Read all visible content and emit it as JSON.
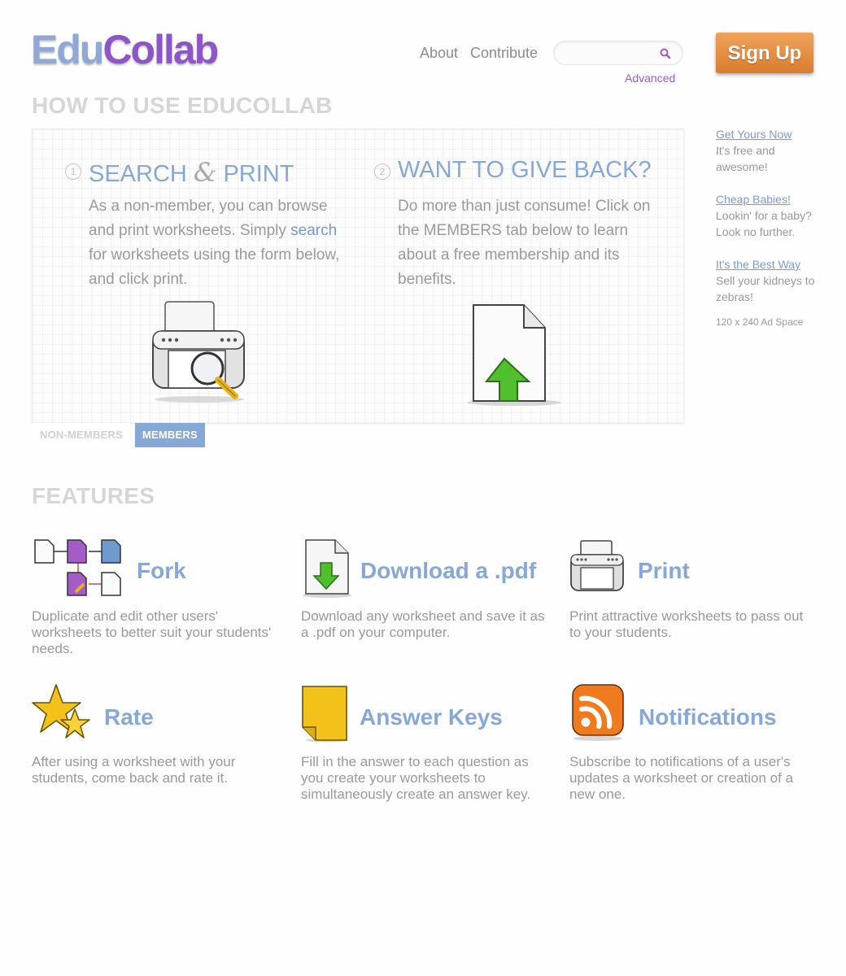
{
  "header": {
    "logo_part1": "Edu",
    "logo_part2": "Collab",
    "nav": [
      "About",
      "Contribute"
    ],
    "search": {
      "value": "",
      "placeholder": ""
    },
    "advanced_link": "Advanced",
    "signup_label": "Sign Up"
  },
  "howto": {
    "title": "HOW TO USE EDUCOLLAB",
    "steps": [
      {
        "number": "1",
        "heading_before": "SEARCH",
        "heading_amp": "&",
        "heading_after": "PRINT",
        "text_before": "As a non-member, you can browse and print worksheets. Simply",
        "text_link": "search",
        "text_after": "for worksheets using the form below, and click print."
      },
      {
        "number": "2",
        "heading": "WANT TO GIVE BACK?",
        "text": "Do more than just consume! Click on the MEMBERS tab below to learn about a free membership and its benefits."
      }
    ],
    "tabs": [
      "NON-MEMBERS",
      "MEMBERS"
    ],
    "active_tab": "MEMBERS"
  },
  "sidebar": {
    "ads": [
      {
        "link": "Get Yours Now",
        "text": "It's free and awesome!"
      },
      {
        "link": "Cheap Babies!",
        "text": "Lookin' for a baby? Look no further."
      },
      {
        "link": "It's the Best Way",
        "text": "Sell your kidneys to zebras!"
      }
    ],
    "ad_space_label": "120 x 240 Ad Space"
  },
  "features": {
    "title": "FEATURES",
    "items": [
      {
        "icon": "fork-icon",
        "title": "Fork",
        "desc": "Duplicate and edit other users' worksheets to better suit your students' needs."
      },
      {
        "icon": "download-pdf-icon",
        "title": "Download a .pdf",
        "desc": "Download any worksheet and save it as a .pdf on your computer."
      },
      {
        "icon": "printer-icon",
        "title": "Print",
        "desc": "Print attractive worksheets to pass out to your students."
      },
      {
        "icon": "star-icon",
        "title": "Rate",
        "desc": "After using a worksheet with your students, come back and rate it."
      },
      {
        "icon": "answer-key-icon",
        "title": "Answer Keys",
        "desc": "Fill in the answer to each question as you create your worksheets to simultaneously create an answer key."
      },
      {
        "icon": "rss-icon",
        "title": "Notifications",
        "desc": "Subscribe to notifications of a user's updates a worksheet or creation of a new one."
      }
    ]
  },
  "colors": {
    "accent_blue": "#86a8d6",
    "logo_purple": "#8d55c8",
    "signup_orange": "#e08a3a",
    "heading_gray": "#d6d6d6"
  }
}
